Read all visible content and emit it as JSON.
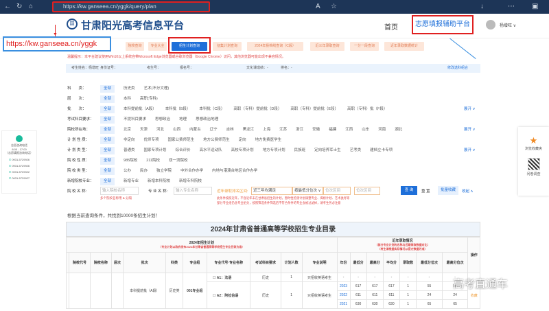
{
  "browser": {
    "url": "https://kw.ganseea.cn/yggk/query/plan"
  },
  "header": {
    "logo_text": "国",
    "title": "甘肃阳光高考信息平台",
    "home": "首页",
    "assist": "志愿填报辅助平台",
    "user": "杨增旺 ∨"
  },
  "annotation": {
    "url_label": "https://kw.ganseea.cn/yggk"
  },
  "nav": [
    "院校查询",
    "专业大全",
    "招生计划查询",
    "征集计划查询",
    "2024年投档线查询（C段）",
    "近三年录取查询",
    "一分一段查询",
    "近年录取数据统计"
  ],
  "nav_active": 2,
  "warning": "温馨提示：本平台建议使用Win10以上系统自带Microsoft Edge浏览器或谷歌浏览器（Google Chrome）访问，其他浏览器可能出现不兼容情况。",
  "userbar": {
    "name": "考生姓名：杨增旺",
    "id": "身份证号：",
    "exam_no": "考生号：",
    "reg_no": "报名号：",
    "score": "文化课成绩：-",
    "rank": "排名：-",
    "edit": "修改选科组合"
  },
  "filters": [
    {
      "label": "科　　类：",
      "options": [
        "全部",
        "历史类",
        "艺术(不分文理)"
      ]
    },
    {
      "label": "层　　次：",
      "options": [
        "全部",
        "本科",
        "高职(专科)"
      ]
    },
    {
      "label": "批　　次：",
      "options": [
        "全部",
        "本科提前批（A段）",
        "本科批（B段）",
        "本科批（C段）",
        "高职（专科）提前批（D段）",
        "高职（专科）提前批（E段）",
        "高职（专科）批（F段）"
      ],
      "expand": "展开 ∨"
    },
    {
      "label": "考试科目要求：",
      "options": [
        "全部",
        "不提科目要求",
        "思想政治",
        "地理",
        "思想政治地理"
      ]
    },
    {
      "label": "院校所在地：",
      "options": [
        "全部",
        "北京",
        "天津",
        "河北",
        "山西",
        "内蒙古",
        "辽宁",
        "吉林",
        "黑龙江",
        "上海",
        "江苏",
        "浙江",
        "安徽",
        "福建",
        "江西",
        "山东",
        "河南",
        "湖北"
      ],
      "expand": "展开 ∨"
    },
    {
      "label": "计 划 性 质：",
      "options": [
        "全部",
        "非定向",
        "优师专项",
        "国家公费师范生",
        "地方公费师范生",
        "定向",
        "地方免费医学生"
      ]
    },
    {
      "label": "计 划 类 型：",
      "options": [
        "全部",
        "普通类",
        "国家专项计划",
        "综合评价",
        "高水平运动队",
        "高校专项计划",
        "地方专项计划",
        "民族班",
        "定向培养军士生",
        "艺考类",
        "建档立卡专项"
      ],
      "expand": "展开 ∨"
    },
    {
      "label": "院 校 性 质：",
      "options": [
        "全部",
        "985院校",
        "211院校",
        "双一流院校"
      ]
    },
    {
      "label": "院 校 类 型：",
      "options": [
        "全部",
        "公办",
        "民办",
        "独立学院",
        "中外合作办学",
        "内地与港澳台地区合作办学"
      ]
    },
    {
      "label": "新增院校专业：",
      "options": [
        "全部",
        "新增专业",
        "新增本科院校",
        "新增专科院校"
      ]
    }
  ],
  "search": {
    "school_label": "院 校 名 称:",
    "school_ph": "输入院校名称",
    "school_hint": "多个院校名称用 & 分隔",
    "major_label": "专 业 名 称:",
    "major_ph": "输入专业名称",
    "recent_label": "近年录取排名区间:",
    "recent_value": "近三年均满足",
    "sort_value": "按最低分位次 ∨",
    "from_ph": "位次区间",
    "to_ph": "位次区间",
    "hint1": "此条件按照近年，不含近年未在甘肃省招生的计划，暂时性检测计划调整专业、揭榜计划、艺术类考等",
    "hint2": "部分专业组仍含专业组分，按照筛选条件筛选后不符合条件的专业会被过滤掉，请考生务必注意",
    "query": "查 询",
    "reset": "重 置",
    "batch": "批量收藏",
    "collapse": "收起 ∧"
  },
  "results": "根据当前查询条件，共找到10000条招生计划！",
  "table": {
    "title": "2024年甘肃省普通高等学校招生专业目录",
    "plan_header": "2024年招生计划",
    "plan_note": "（专业计划以政府发布2024年甘肃省普通高等学校招生专业目录为准）",
    "recent_header": "近年录取情况",
    "recent_note1": "（部分专业计划的名称与近期录取数据对比）",
    "recent_note2": "（考生请根据实际情况以官方数据为准）",
    "action": "操作",
    "columns": [
      "院校代号",
      "院校名称",
      "层次",
      "批次",
      "科类",
      "专业组",
      "专业代号·专业名称",
      "考试科目要求",
      "计划人数",
      "专业说明",
      "年份",
      "最低分",
      "最高分",
      "平均分",
      "录取数",
      "最低分位次",
      "最高分位次"
    ],
    "group": "001专业组",
    "batch": "本科提前批（A段）",
    "subject": "历史类",
    "rows": [
      {
        "major": "A1：法语",
        "req": "历史",
        "plan": "1",
        "note": "只招收英语考生",
        "years": [
          [
            "-",
            "-",
            "-",
            "-",
            "-",
            "-",
            "-"
          ]
        ]
      },
      {
        "major": "A2：阿拉伯语",
        "req": "历史",
        "plan": "1",
        "note": "只招收英语考生",
        "years": [
          [
            "2023",
            "617",
            "617",
            "617",
            "1",
            "55",
            "55"
          ],
          [
            "2022",
            "611",
            "611",
            "611",
            "1",
            "24",
            "24"
          ],
          [
            "2021",
            "630",
            "630",
            "630",
            "1",
            "65",
            "65"
          ]
        ],
        "action": "收藏"
      }
    ]
  },
  "left_panel": {
    "title": "志愿咨询电话",
    "hours": "8:00 - 17:00",
    "sub": "（志愿填报咨询电话）",
    "phones": [
      "0931-5729926",
      "0931-5729926",
      "0931-5729922",
      "0931-5729927"
    ]
  },
  "right_panel": {
    "fav": "浏览收藏夹",
    "survey": "问卷调查"
  },
  "watermark": "高考直通车"
}
